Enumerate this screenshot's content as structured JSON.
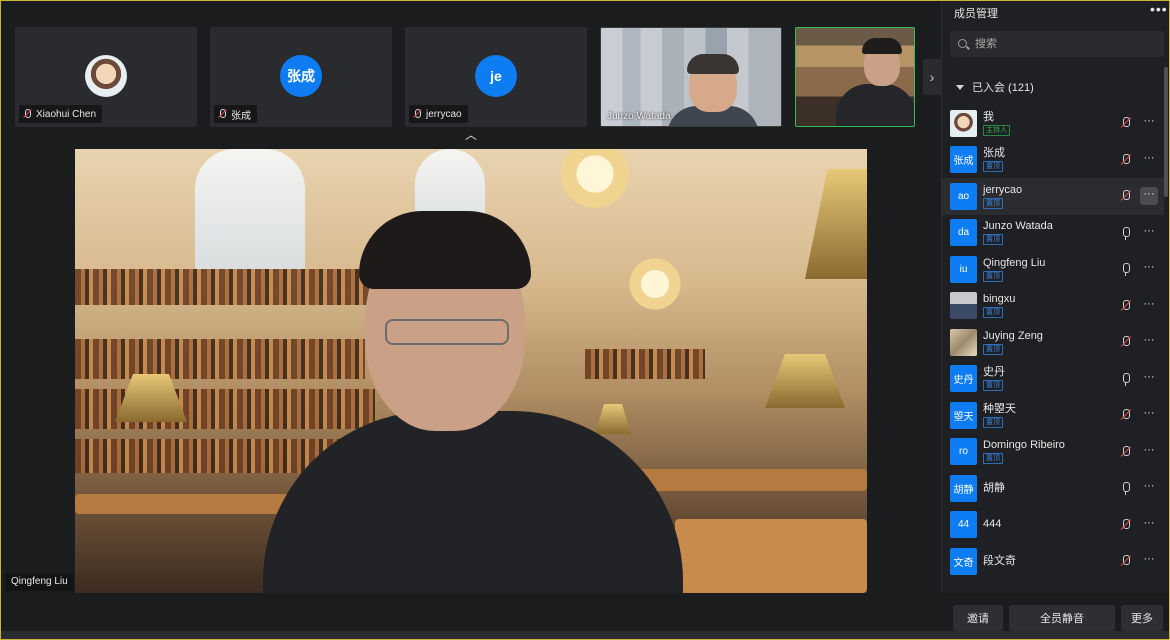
{
  "thumbnails": [
    {
      "name": "Xiaohui Chen",
      "avatar": ""
    },
    {
      "name": "张成",
      "avatar": "张成"
    },
    {
      "name": "jerrycao",
      "avatar": "je"
    },
    {
      "name": "Junzo Watada"
    },
    {
      "name": ""
    }
  ],
  "main_video": {
    "speaker": "Qingfeng Liu"
  },
  "panel": {
    "title": "成员管理",
    "more": "•••",
    "search_placeholder": "搜索",
    "group_label": "已入会 (121)"
  },
  "members": [
    {
      "avatar": "",
      "name": "我",
      "tag": "主持人",
      "mic": "muted"
    },
    {
      "avatar": "张成",
      "name": "张成",
      "tag": "置顶",
      "mic": "muted"
    },
    {
      "avatar": "ao",
      "name": "jerrycao",
      "tag": "置顶",
      "mic": "muted"
    },
    {
      "avatar": "da",
      "name": "Junzo Watada",
      "tag": "置顶",
      "mic": "on"
    },
    {
      "avatar": "iu",
      "name": "Qingfeng Liu",
      "tag": "置顶",
      "mic": "on"
    },
    {
      "avatar": "",
      "name": "bingxu",
      "tag": "置顶",
      "mic": "muted"
    },
    {
      "avatar": "",
      "name": "Juying Zeng",
      "tag": "置顶",
      "mic": "muted"
    },
    {
      "avatar": "史丹",
      "name": "史丹",
      "tag": "置顶",
      "mic": "on"
    },
    {
      "avatar": "曌天",
      "name": "种曌天",
      "tag": "置顶",
      "mic": "muted"
    },
    {
      "avatar": "ro",
      "name": "Domingo Ribeiro",
      "tag": "置顶",
      "mic": "muted"
    },
    {
      "avatar": "胡静",
      "name": "胡静",
      "tag": "",
      "mic": "on"
    },
    {
      "avatar": "44",
      "name": "444",
      "tag": "",
      "mic": "muted"
    },
    {
      "avatar": "文奇",
      "name": "段文奇",
      "tag": "",
      "mic": "muted"
    }
  ],
  "bottom": {
    "invite": "邀请",
    "mute_all": "全员静音",
    "more": "更多"
  },
  "colors": {
    "accent": "#0e7cf2",
    "active_border": "#2fbf5a",
    "muted": "#e04a4a",
    "window_border": "#c9b53a"
  }
}
